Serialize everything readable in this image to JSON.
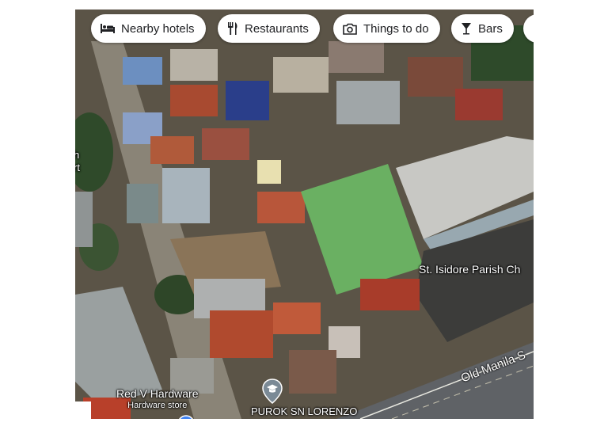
{
  "chips": [
    {
      "label": "Nearby hotels",
      "icon": "bed-icon"
    },
    {
      "label": "Restaurants",
      "icon": "fork-knife-icon"
    },
    {
      "label": "Things to do",
      "icon": "camera-icon"
    },
    {
      "label": "Bars",
      "icon": "cocktail-icon"
    }
  ],
  "map": {
    "view": "satellite",
    "places": {
      "church": "St. Isidore Parish Ch",
      "hardware_name": "Red V Hardware",
      "hardware_category": "Hardware store",
      "purok": "PUROK SN LORENZO"
    },
    "road": "Old Manila S",
    "edge_text": {
      "line1": "h",
      "line2": "rt"
    }
  },
  "colors": {
    "chip_bg": "#ffffff",
    "marker_blue": "#4285f4",
    "marker_gray": "#7b8a96"
  }
}
